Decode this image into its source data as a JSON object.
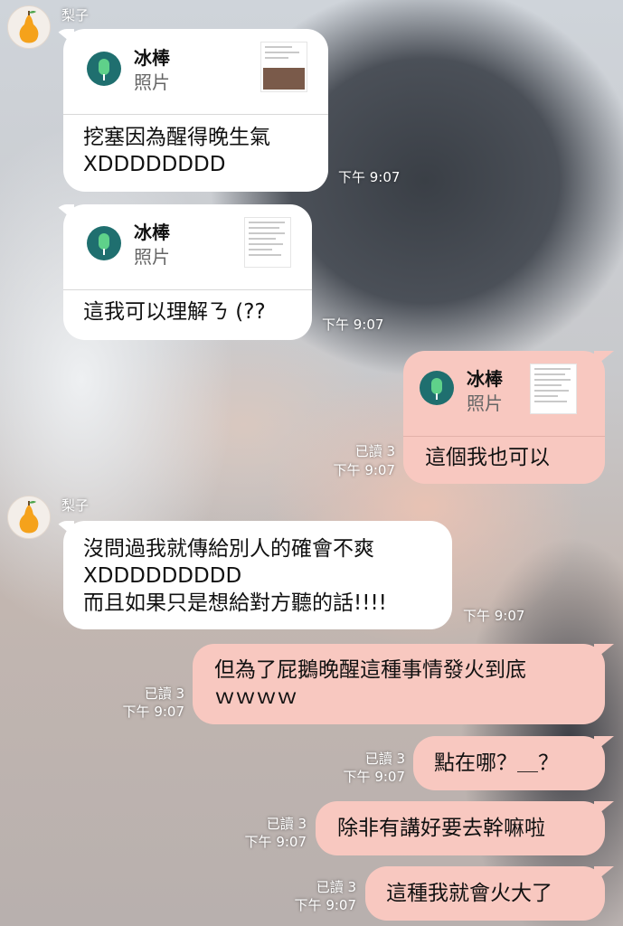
{
  "contact_name": "梨子",
  "colors": {
    "incoming_bubble": "#ffffff",
    "outgoing_bubble": "#f8c8c0",
    "card_logo": "#1f6f6f"
  },
  "messages": [
    {
      "card": {
        "title": "冰棒",
        "subtitle": "照片"
      },
      "text": "挖塞因為醒得晚生氣\nXDDDDDDDD",
      "time": "下午 9:07"
    },
    {
      "card": {
        "title": "冰棒",
        "subtitle": "照片"
      },
      "text": "這我可以理解ㄋ (??",
      "time": "下午 9:07"
    },
    {
      "card": {
        "title": "冰棒",
        "subtitle": "照片"
      },
      "text": "這個我也可以",
      "read": "已讀 3",
      "time": "下午 9:07"
    },
    {
      "text": "沒問過我就傳給別人的確會不爽\nXDDDDDDDDD\n而且如果只是想給對方聽的話!!!!",
      "time": "下午 9:07"
    },
    {
      "text": "但為了屁鵝晚醒這種事情發火到底\nｗｗｗｗ",
      "read": "已讀 3",
      "time": "下午 9:07"
    },
    {
      "text": "點在哪？＿？",
      "read": "已讀 3",
      "time": "下午 9:07"
    },
    {
      "text": "除非有講好要去幹嘛啦",
      "read": "已讀 3",
      "time": "下午 9:07"
    },
    {
      "text": "這種我就會火大了",
      "read": "已讀 3",
      "time": "下午 9:07"
    }
  ]
}
